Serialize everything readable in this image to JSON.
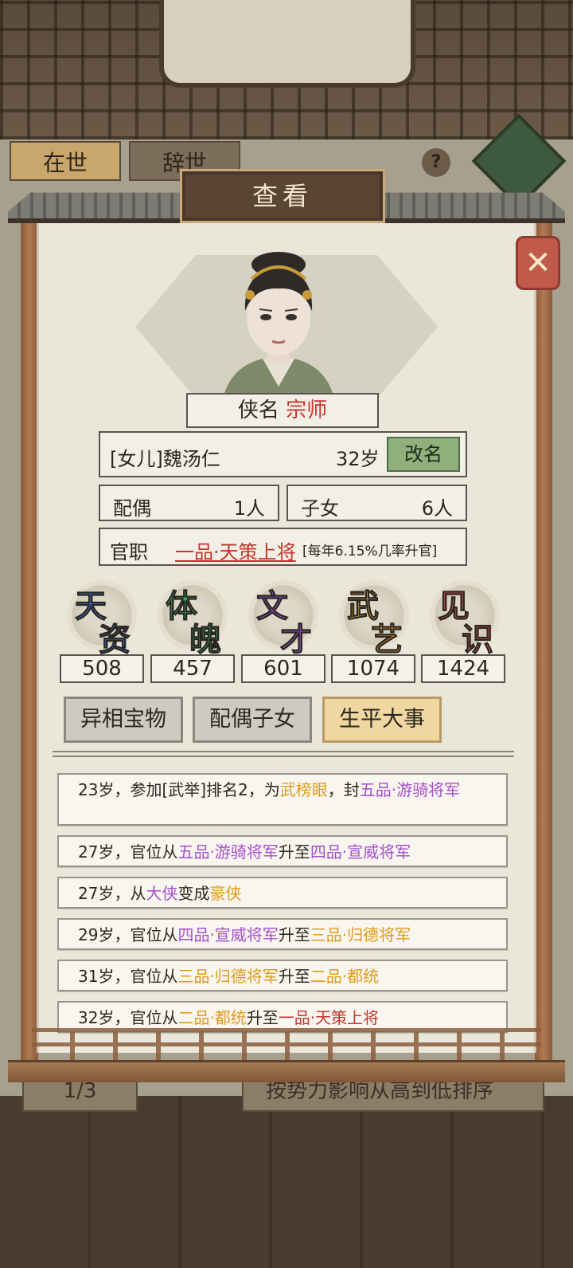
{
  "background": {
    "tabs": [
      "在世",
      "辞世"
    ],
    "help_icon": "?",
    "pager": "1/3",
    "sort_label": "按势力影响从高到低排序"
  },
  "dialog": {
    "title": "查看",
    "close_icon": "close-icon",
    "hero_title_label": "侠名",
    "hero_title_value": "宗师",
    "name": "[女儿]魏汤仁",
    "age": "32岁",
    "rename_label": "改名",
    "spouse_label": "配偶",
    "spouse_value": "1人",
    "children_label": "子女",
    "children_value": "6人",
    "office_label": "官职",
    "office_value": "一品·天策上将",
    "office_note": "[每年6.15%几率升官]"
  },
  "stats": [
    {
      "c1": "天",
      "c2": "资",
      "value": "508",
      "color": "#3b6fe0"
    },
    {
      "c1": "体",
      "c2": "魄",
      "value": "457",
      "color": "#2fb36a"
    },
    {
      "c1": "文",
      "c2": "才",
      "value": "601",
      "color": "#9a4fd0"
    },
    {
      "c1": "武",
      "c2": "艺",
      "value": "1074",
      "color": "#e8a23a"
    },
    {
      "c1": "见",
      "c2": "识",
      "value": "1424",
      "color": "#d9584c"
    }
  ],
  "tabs": {
    "treasure": "异相宝物",
    "family": "配偶子女",
    "events": "生平大事"
  },
  "events": [
    {
      "p1": "23岁，参加[武举]排名2，为",
      "h1": "武榜眼",
      "p2": "，封",
      "h2": "五品·游骑将军",
      "p3": ""
    },
    {
      "p1": "27岁，官位从",
      "h1": "五品·游骑将军",
      "p2": "升至",
      "h2": "四品·宣威将军",
      "p3": ""
    },
    {
      "p1": "27岁，从",
      "h1": "大侠",
      "p2": "变成",
      "h2": "豪侠",
      "p3": ""
    },
    {
      "p1": "29岁，官位从",
      "h1": "四品·宣威将军",
      "p2": "升至",
      "h2": "三品·归德将军",
      "p3": ""
    },
    {
      "p1": "31岁，官位从",
      "h1": "三品·归德将军",
      "p2": "升至",
      "h2": "二品·都统",
      "p3": ""
    },
    {
      "p1": "32岁，官位从",
      "h1": "二品·都统",
      "p2": "升至",
      "h2": "一品·天策上将",
      "p3": ""
    }
  ]
}
